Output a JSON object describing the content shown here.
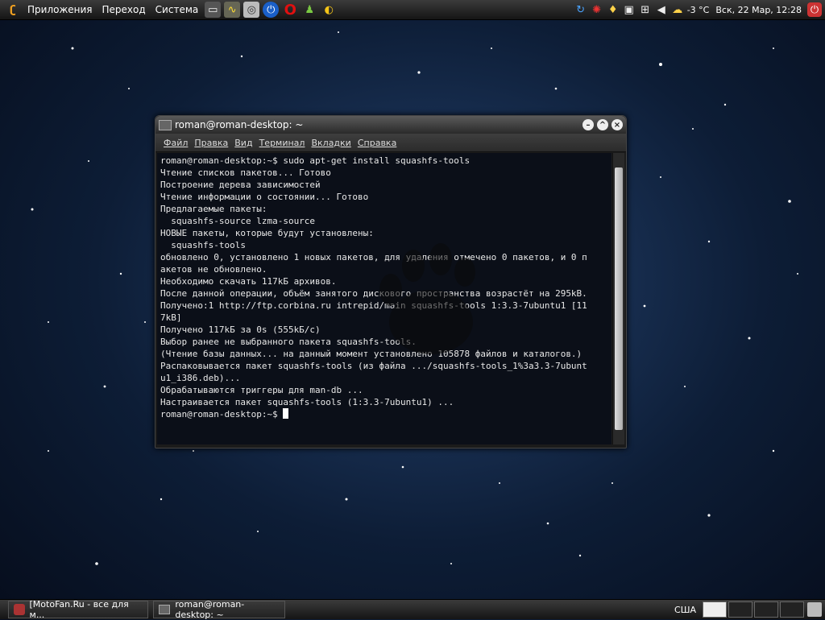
{
  "top_panel": {
    "menus": [
      "Приложения",
      "Переход",
      "Система"
    ],
    "clock": "Вск, 22 Мар, 12:28",
    "weather": "-3 °C"
  },
  "window": {
    "title": "roman@roman-desktop: ~",
    "menu": [
      "Файл",
      "Правка",
      "Вид",
      "Терминал",
      "Вкладки",
      "Справка"
    ],
    "lines": [
      "roman@roman-desktop:~$ sudo apt-get install squashfs-tools",
      "Чтение списков пакетов... Готово",
      "Построение дерева зависимостей",
      "Чтение информации о состоянии... Готово",
      "Предлагаемые пакеты:",
      "  squashfs-source lzma-source",
      "НОВЫЕ пакеты, которые будут установлены:",
      "  squashfs-tools",
      "обновлено 0, установлено 1 новых пакетов, для удаления отмечено 0 пакетов, и 0 п",
      "акетов не обновлено.",
      "Необходимо скачать 117kБ архивов.",
      "После данной операции, объём занятого дискового пространства возрастёт на 295kB.",
      "Получено:1 http://ftp.corbina.ru intrepid/main squashfs-tools 1:3.3-7ubuntu1 [11",
      "7kB]",
      "Получено 117kБ за 0s (555kБ/c)",
      "Выбор ранее не выбранного пакета squashfs-tools.",
      "(Чтение базы данных... на данный момент установлено 105878 файлов и каталогов.)",
      "Распаковывается пакет squashfs-tools (из файла .../squashfs-tools_1%3a3.3-7ubunt",
      "u1_i386.deb)...",
      "Обрабатываются триггеры для man-db ...",
      "Настраивается пакет squashfs-tools (1:3.3-7ubuntu1) ..."
    ],
    "prompt": "roman@roman-desktop:~$ "
  },
  "bottom_panel": {
    "tasks": [
      "[MotoFan.Ru - все для м...",
      "roman@roman-desktop: ~"
    ],
    "keyboard_layout": "США"
  }
}
